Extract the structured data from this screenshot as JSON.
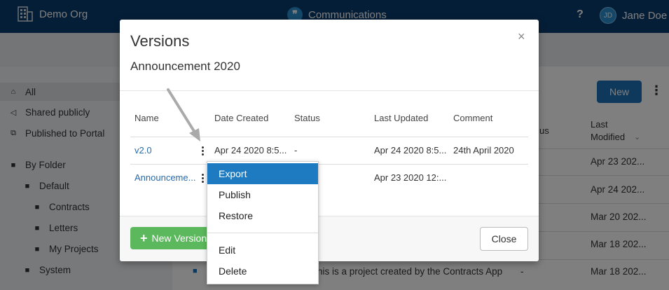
{
  "header": {
    "org_name": "Demo Org",
    "app_name": "Communications",
    "help": "?",
    "user_initials": "JD",
    "user_name": "Jane Doe"
  },
  "sidebar": {
    "items": [
      {
        "label": "All",
        "icon": "home-icon"
      },
      {
        "label": "Shared publicly",
        "icon": "share-icon"
      },
      {
        "label": "Published to Portal",
        "icon": "external-link-icon"
      },
      {
        "label": "By Folder",
        "icon": "folder-icon"
      },
      {
        "label": "Default",
        "icon": "briefcase-icon"
      },
      {
        "label": "Contracts",
        "icon": "folder-icon"
      },
      {
        "label": "Letters",
        "icon": "folder-icon"
      },
      {
        "label": "My Projects",
        "icon": "folder-icon"
      },
      {
        "label": "System",
        "icon": "briefcase-icon"
      }
    ]
  },
  "main": {
    "new_label": "New",
    "col_status_partial": "us",
    "col_last_modified": "Last\nModified",
    "rows": [
      {
        "modified": "Apr 23 202..."
      },
      {
        "modified": "Apr 24 202..."
      },
      {
        "modified": "Mar 20 202..."
      },
      {
        "modified": "Mar 18 202..."
      },
      {
        "modified": "Mar 18 202..."
      }
    ],
    "partial_description": "his is a project created by the Contracts App",
    "dash": "-"
  },
  "modal": {
    "title": "Versions",
    "subtitle": "Announcement 2020",
    "close_icon": "×",
    "columns": [
      "Name",
      "Date Created",
      "Status",
      "Last Updated",
      "Comment"
    ],
    "rows": [
      {
        "name": "v2.0",
        "date_created": "Apr 24 2020 8:5...",
        "status": "-",
        "last_updated": "Apr 24 2020 8:5...",
        "comment": "24th April 2020"
      },
      {
        "name": "Announceme...",
        "date_created": "",
        "status": "",
        "last_updated": "Apr 23 2020 12:...",
        "comment": ""
      }
    ],
    "new_version_label": "New Version",
    "close_label": "Close"
  },
  "context_menu": {
    "items": [
      "Export",
      "Publish",
      "Restore",
      "Edit",
      "Delete"
    ],
    "active_index": 0
  },
  "colors": {
    "topbar": "#0b3d6e",
    "accent": "#1e72b8",
    "success": "#5cb85c",
    "menu_active": "#1e7bc2",
    "link": "#2a6aa8"
  }
}
